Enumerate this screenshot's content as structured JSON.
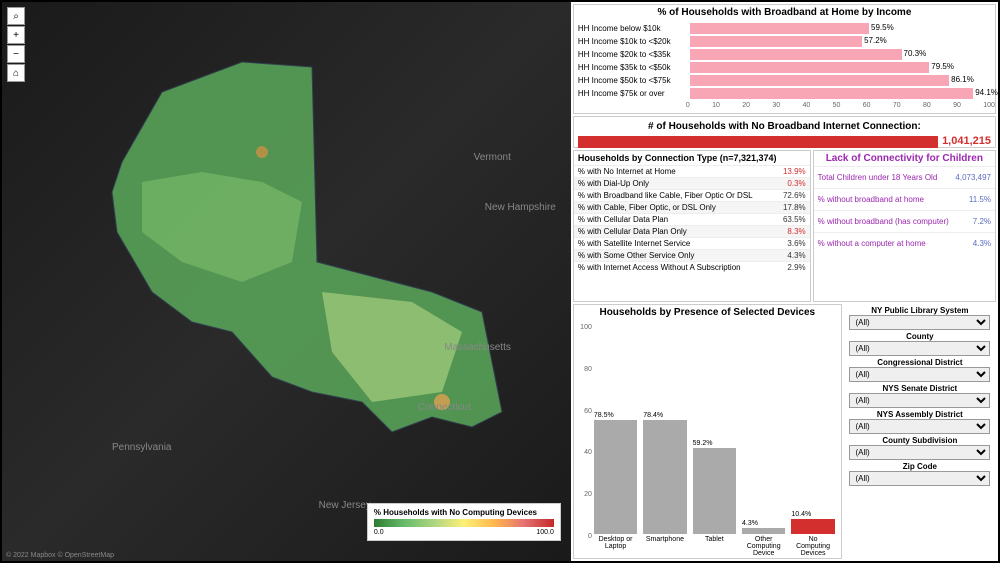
{
  "map": {
    "legend_title": "% Households with No Computing Devices",
    "legend_min": "0.0",
    "legend_max": "100.0",
    "attrib": "© 2022 Mapbox  © OpenStreetMap",
    "labels": {
      "vt": "Vermont",
      "nh": "New Hampshire",
      "ma": "Massachusetts",
      "ct": "Connecticut",
      "pa": "Pennsylvania",
      "nj": "New Jersey"
    }
  },
  "chart_data": [
    {
      "type": "bar",
      "title": "% of Households with Broadband at Home by Income",
      "categories": [
        "HH Income below $10k",
        "HH Income $10k to <$20k",
        "HH Income $20k to <$35k",
        "HH Income $35k to <$50k",
        "HH Income $50k to <$75k",
        "HH Income $75k or over"
      ],
      "values": [
        59.5,
        57.2,
        70.3,
        79.5,
        86.1,
        94.1
      ],
      "xlim": [
        0,
        100
      ],
      "xticks": [
        0,
        10,
        20,
        30,
        40,
        50,
        60,
        70,
        80,
        90,
        100
      ],
      "orientation": "horizontal"
    },
    {
      "type": "bar",
      "title": "Households by Presence of Selected Devices",
      "categories": [
        "Desktop or Laptop",
        "Smartphone",
        "Tablet",
        "Other Computing Device",
        "No Computing Devices"
      ],
      "values": [
        78.5,
        78.4,
        59.2,
        4.3,
        10.4
      ],
      "ylim": [
        0,
        100
      ],
      "yticks": [
        0,
        20,
        40,
        60,
        80,
        100
      ],
      "highlight_index": 4
    }
  ],
  "no_broadband": {
    "title": "# of Households with No Broadband Internet Connection:",
    "value": "1,041,215"
  },
  "connection": {
    "title": "Households by Connection Type (n=7,321,374)",
    "rows": [
      {
        "label": "% with No Internet at Home",
        "val": "13.9%",
        "red": true
      },
      {
        "label": "% with Dial-Up Only",
        "val": "0.3%",
        "red": true
      },
      {
        "label": "% with Broadband like Cable, Fiber Optic Or DSL",
        "val": "72.6%",
        "red": false
      },
      {
        "label": "    % with Cable, Fiber Optic, or DSL Only",
        "val": "17.8%",
        "red": false
      },
      {
        "label": "% with Cellular Data Plan",
        "val": "63.5%",
        "red": false
      },
      {
        "label": "    % with Cellular Data Plan Only",
        "val": "8.3%",
        "red": true
      },
      {
        "label": "% with Satellite Internet Service",
        "val": "3.6%",
        "red": false
      },
      {
        "label": "% with Some Other Service Only",
        "val": "4.3%",
        "red": false
      },
      {
        "label": "% with Internet Access Without A Subscription",
        "val": "2.9%",
        "red": false
      }
    ]
  },
  "children": {
    "title": "Lack of Connectivity for Children",
    "rows": [
      {
        "label": "Total Children under 18 Years Old",
        "val": "4,073,497"
      },
      {
        "label": "% without broadband at home",
        "val": "11.5%"
      },
      {
        "label": "% without broadband (has computer)",
        "val": "7.2%"
      },
      {
        "label": "% without a computer at home",
        "val": "4.3%"
      }
    ]
  },
  "filters": {
    "all_label": "(All)",
    "items": [
      "NY Public Library System",
      "County",
      "Congressional District",
      "NYS Senate District",
      "NYS Assembly District",
      "County Subdivision",
      "Zip Code"
    ]
  }
}
